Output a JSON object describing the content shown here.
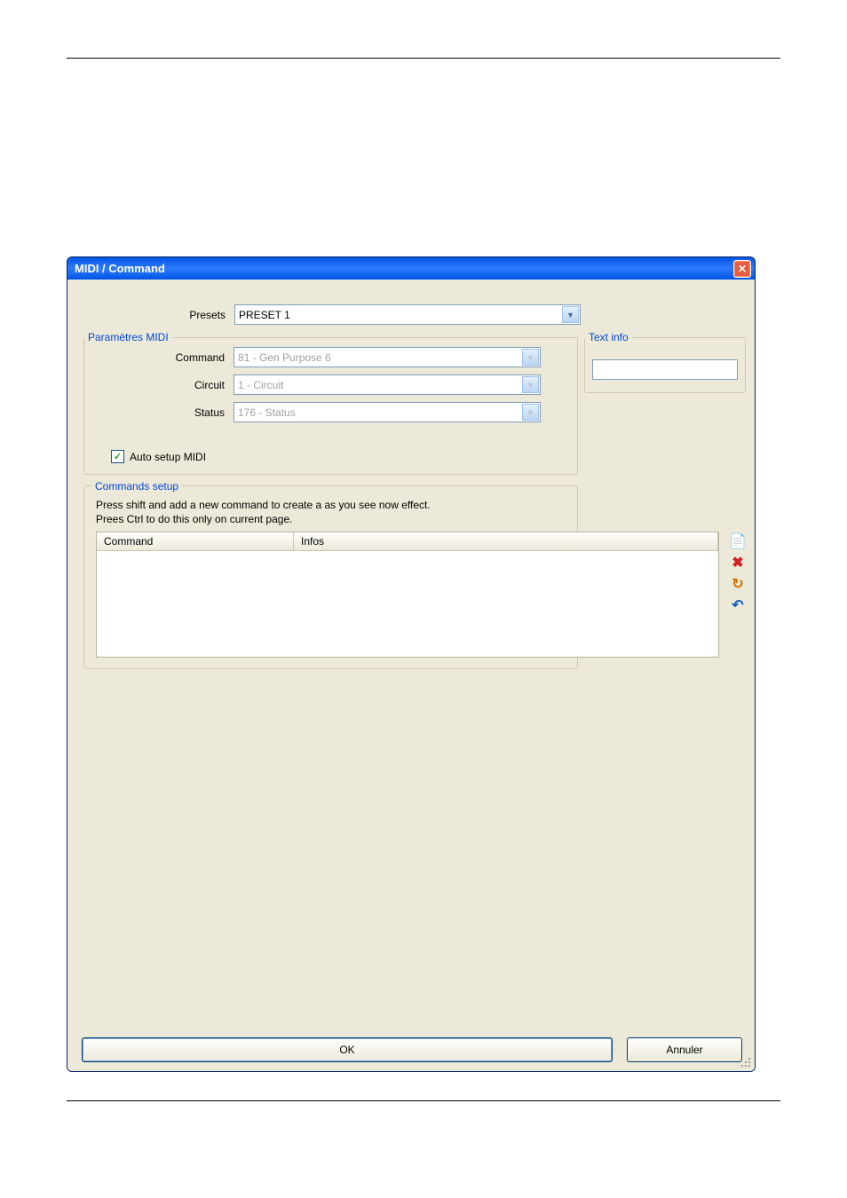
{
  "window": {
    "title": "MIDI / Command"
  },
  "presets": {
    "label": "Presets",
    "value": "PRESET 1"
  },
  "midi_params": {
    "legend": "Paramètres MIDI",
    "command": {
      "label": "Command",
      "value": "81 - Gen Purpose 6"
    },
    "circuit": {
      "label": "Circuit",
      "value": "1 - Circuit"
    },
    "status": {
      "label": "Status",
      "value": "176 - Status"
    },
    "auto_setup": {
      "label": "Auto setup MIDI",
      "checked": true
    }
  },
  "text_info": {
    "legend": "Text info",
    "value": ""
  },
  "commands_setup": {
    "legend": "Commands setup",
    "help_line1": "Press shift and add a new command to create a as you see now effect.",
    "help_line2": "Prees Ctrl to do this only on current page.",
    "columns": {
      "col1": "Command",
      "col2": "Infos"
    },
    "rows": []
  },
  "buttons": {
    "ok": "OK",
    "cancel": "Annuler"
  },
  "icons": {
    "new": "📄",
    "delete": "✖",
    "refresh": "↻",
    "undo": "↶"
  }
}
